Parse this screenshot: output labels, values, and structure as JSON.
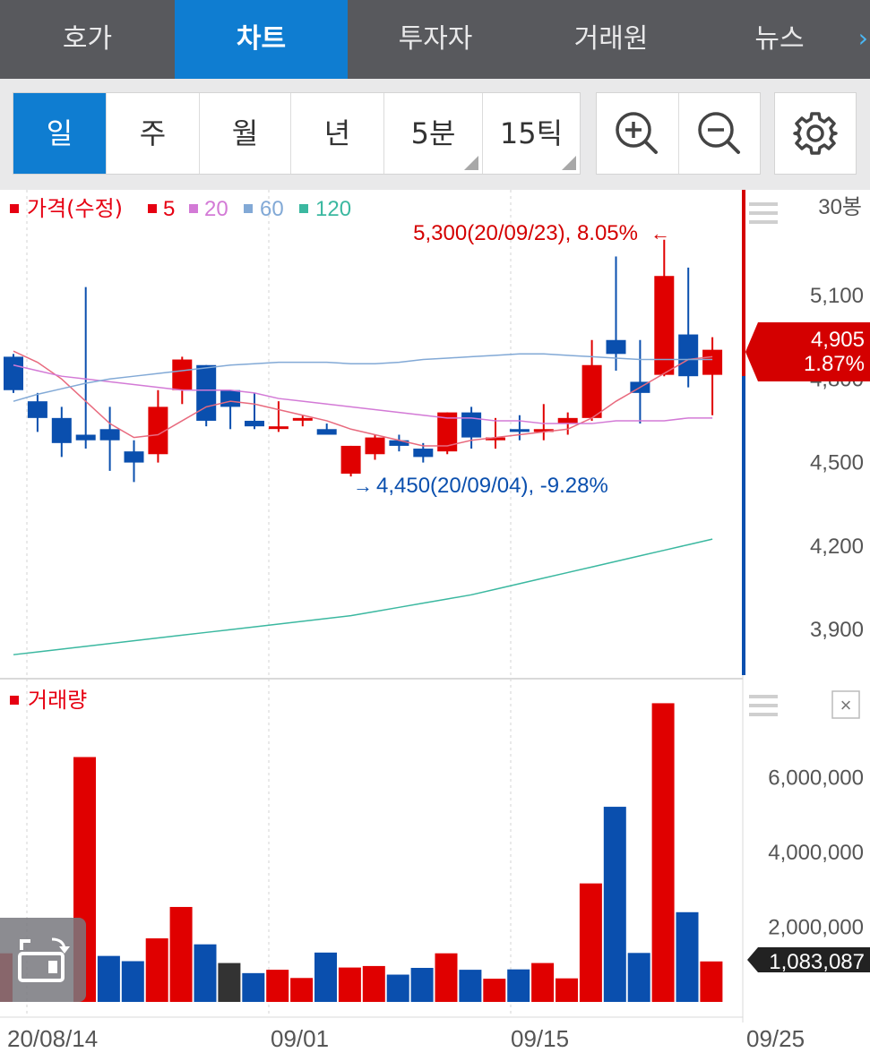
{
  "tabs": [
    {
      "label": "호가",
      "active": false
    },
    {
      "label": "차트",
      "active": true
    },
    {
      "label": "투자자",
      "active": false
    },
    {
      "label": "거래원",
      "active": false
    },
    {
      "label": "뉴스",
      "active": false
    }
  ],
  "tab_more_icon": "chevron-right-icon",
  "periods": [
    {
      "label": "일",
      "active": true
    },
    {
      "label": "주",
      "active": false
    },
    {
      "label": "월",
      "active": false
    },
    {
      "label": "년",
      "active": false
    },
    {
      "label": "5분",
      "active": false,
      "dropdown": true
    },
    {
      "label": "15틱",
      "active": false,
      "dropdown": true
    }
  ],
  "tools": {
    "zoom_in_icon": "zoom-in-icon",
    "zoom_out_icon": "zoom-out-icon",
    "settings_icon": "gear-icon"
  },
  "price_panel": {
    "legend": [
      {
        "label": "가격(수정)",
        "color": "#e60012"
      },
      {
        "label": "5",
        "color": "#e60012"
      },
      {
        "label": "20",
        "color": "#d37ad6"
      },
      {
        "label": "60",
        "color": "#82a9d6"
      },
      {
        "label": "120",
        "color": "#3bb8a0"
      }
    ],
    "candle_count_label": "30봉",
    "high_annotation": "5,300(20/09/23), 8.05%",
    "low_annotation": "4,450(20/09/04), -9.28%",
    "current_price": "4,905",
    "current_change": "1.87%"
  },
  "volume_panel": {
    "legend_label": "거래량",
    "current_volume": "1,083,087"
  },
  "x_tick_labels": [
    "20/08/14",
    "09/01",
    "09/15",
    "09/25"
  ],
  "colors": {
    "up": "#e00000",
    "down": "#0a4fae",
    "flat": "#333333",
    "tab_bg": "#58595d",
    "accent": "#0f7dd1"
  },
  "chart_data": [
    {
      "type": "candlestick",
      "title": "가격(수정)",
      "y_tick_labels": [
        "5,100",
        "4,800",
        "4,500",
        "4,200",
        "3,900"
      ],
      "ylim": [
        3780,
        5460
      ],
      "candles": [
        {
          "o": 4880,
          "h": 4890,
          "l": 4750,
          "c": 4760
        },
        {
          "o": 4720,
          "h": 4750,
          "l": 4610,
          "c": 4660
        },
        {
          "o": 4660,
          "h": 4700,
          "l": 4520,
          "c": 4570
        },
        {
          "o": 4600,
          "h": 5130,
          "l": 4550,
          "c": 4580
        },
        {
          "o": 4620,
          "h": 4700,
          "l": 4470,
          "c": 4580
        },
        {
          "o": 4540,
          "h": 4580,
          "l": 4430,
          "c": 4500
        },
        {
          "o": 4530,
          "h": 4760,
          "l": 4500,
          "c": 4700
        },
        {
          "o": 4760,
          "h": 4880,
          "l": 4710,
          "c": 4870
        },
        {
          "o": 4850,
          "h": 4850,
          "l": 4630,
          "c": 4650
        },
        {
          "o": 4760,
          "h": 4760,
          "l": 4620,
          "c": 4700
        },
        {
          "o": 4650,
          "h": 4750,
          "l": 4620,
          "c": 4630
        },
        {
          "o": 4630,
          "h": 4720,
          "l": 4610,
          "c": 4630
        },
        {
          "o": 4660,
          "h": 4670,
          "l": 4630,
          "c": 4660
        },
        {
          "o": 4620,
          "h": 4640,
          "l": 4600,
          "c": 4600
        },
        {
          "o": 4460,
          "h": 4560,
          "l": 4450,
          "c": 4560
        },
        {
          "o": 4530,
          "h": 4600,
          "l": 4510,
          "c": 4590
        },
        {
          "o": 4580,
          "h": 4600,
          "l": 4540,
          "c": 4560
        },
        {
          "o": 4550,
          "h": 4570,
          "l": 4500,
          "c": 4520
        },
        {
          "o": 4540,
          "h": 4680,
          "l": 4530,
          "c": 4680
        },
        {
          "o": 4680,
          "h": 4700,
          "l": 4550,
          "c": 4590
        },
        {
          "o": 4580,
          "h": 4660,
          "l": 4550,
          "c": 4590
        },
        {
          "o": 4620,
          "h": 4670,
          "l": 4580,
          "c": 4610
        },
        {
          "o": 4610,
          "h": 4710,
          "l": 4580,
          "c": 4620
        },
        {
          "o": 4640,
          "h": 4680,
          "l": 4600,
          "c": 4660
        },
        {
          "o": 4660,
          "h": 4940,
          "l": 4650,
          "c": 4850
        },
        {
          "o": 4940,
          "h": 5240,
          "l": 4830,
          "c": 4890
        },
        {
          "o": 4790,
          "h": 4940,
          "l": 4640,
          "c": 4750
        },
        {
          "o": 4815,
          "h": 5300,
          "l": 4810,
          "c": 5170
        },
        {
          "o": 4960,
          "h": 5200,
          "l": 4770,
          "c": 4810
        },
        {
          "o": 4815,
          "h": 4950,
          "l": 4670,
          "c": 4905
        }
      ],
      "ma": [
        {
          "name": "5",
          "values": [
            4900,
            4860,
            4800,
            4720,
            4640,
            4590,
            4600,
            4650,
            4700,
            4720,
            4710,
            4690,
            4670,
            4650,
            4620,
            4600,
            4580,
            4560,
            4560,
            4580,
            4590,
            4600,
            4610,
            4620,
            4660,
            4720,
            4770,
            4820,
            4870,
            4880
          ]
        },
        {
          "name": "20",
          "values": [
            4850,
            4830,
            4810,
            4800,
            4790,
            4780,
            4770,
            4760,
            4760,
            4760,
            4750,
            4730,
            4720,
            4710,
            4700,
            4690,
            4680,
            4670,
            4660,
            4660,
            4650,
            4650,
            4640,
            4640,
            4640,
            4650,
            4650,
            4650,
            4660,
            4660
          ]
        },
        {
          "name": "60",
          "values": [
            4720,
            4745,
            4765,
            4785,
            4800,
            4810,
            4820,
            4830,
            4840,
            4850,
            4855,
            4860,
            4860,
            4860,
            4855,
            4855,
            4860,
            4870,
            4875,
            4880,
            4885,
            4890,
            4890,
            4885,
            4880,
            4875,
            4870,
            4870,
            4870,
            4870
          ]
        },
        {
          "name": "120",
          "values": [
            3810,
            3820,
            3830,
            3840,
            3850,
            3860,
            3870,
            3880,
            3890,
            3900,
            3910,
            3920,
            3930,
            3940,
            3950,
            3965,
            3980,
            3995,
            4010,
            4025,
            4045,
            4065,
            4085,
            4105,
            4125,
            4145,
            4165,
            4185,
            4205,
            4225
          ]
        }
      ]
    },
    {
      "type": "bar",
      "title": "거래량",
      "y_tick_labels": [
        "6,000,000",
        "4,000,000",
        "2,000,000"
      ],
      "ylim": [
        0,
        7800000
      ],
      "values": [
        1300000,
        6550000,
        1230000,
        1090000,
        1700000,
        2540000,
        1540000,
        1040000,
        770000,
        860000,
        640000,
        1320000,
        920000,
        960000,
        730000,
        910000,
        1300000,
        860000,
        620000,
        870000,
        1040000,
        630000,
        3170000,
        5220000,
        1310000,
        7990000,
        2400000,
        1083087
      ],
      "colors": [
        "up",
        "up",
        "down",
        "down",
        "up",
        "up",
        "down",
        "flat",
        "down",
        "up",
        "up",
        "down",
        "up",
        "up",
        "down",
        "down",
        "up",
        "down",
        "up",
        "down",
        "up",
        "up",
        "up",
        "down",
        "down",
        "up",
        "down",
        "up"
      ]
    }
  ]
}
